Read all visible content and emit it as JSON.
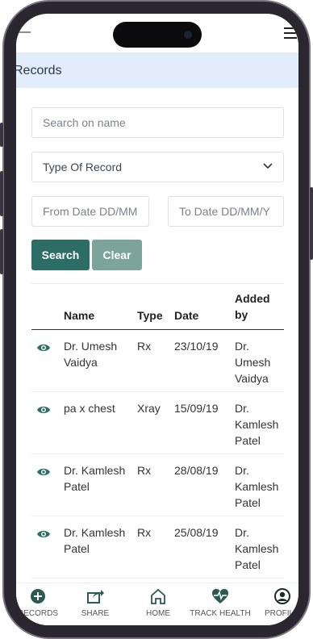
{
  "page": {
    "title": "Records",
    "accent_color": "#2c6e65",
    "title_bar_color": "#e3ecfb"
  },
  "filters": {
    "search_placeholder": "Search on name",
    "record_type_selected": "Type Of Record",
    "from_date_placeholder": "From Date DD/MM",
    "to_date_placeholder": "To Date DD/MM/Y",
    "search_label": "Search",
    "clear_label": "Clear"
  },
  "table": {
    "columns": [
      "Name",
      "Type",
      "Date",
      "Added by"
    ],
    "rows": [
      {
        "name": "Dr. Umesh Vaidya",
        "type": "Rx",
        "date": "23/10/19",
        "added_by": "Dr. Umesh Vaidya"
      },
      {
        "name": "pa x chest",
        "type": "Xray",
        "date": "15/09/19",
        "added_by": "Dr. Kamlesh Patel"
      },
      {
        "name": "Dr. Kamlesh Patel",
        "type": "Rx",
        "date": "28/08/19",
        "added_by": "Dr. Kamlesh Patel"
      },
      {
        "name": "Dr. Kamlesh Patel",
        "type": "Rx",
        "date": "25/08/19",
        "added_by": "Dr. Kamlesh Patel"
      }
    ]
  },
  "bottom_nav": [
    {
      "label": "RECORDS",
      "icon": "plus-circle-icon"
    },
    {
      "label": "SHARE",
      "icon": "share-icon"
    },
    {
      "label": "HOME",
      "icon": "home-icon"
    },
    {
      "label": "TRACK HEALTH",
      "icon": "heartbeat-icon"
    },
    {
      "label": "PROFILE",
      "icon": "user-circle-icon"
    }
  ]
}
